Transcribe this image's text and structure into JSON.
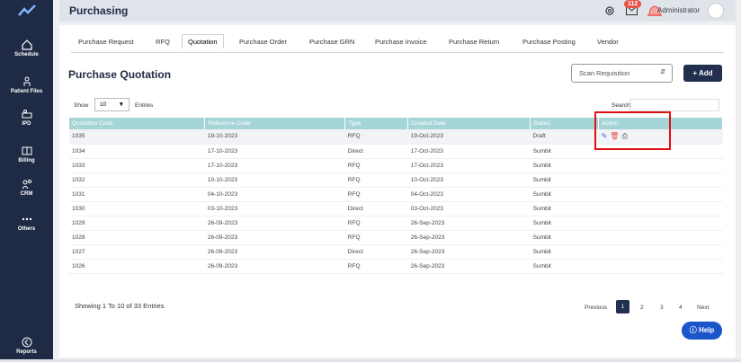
{
  "header": {
    "title": "Purchasing",
    "notifications": "112",
    "user": "Administrator"
  },
  "sidebar": {
    "items": [
      {
        "label": "Schedule",
        "icon": "home-icon"
      },
      {
        "label": "Patient Files",
        "icon": "person-icon"
      },
      {
        "label": "IPD",
        "icon": "bed-icon"
      },
      {
        "label": "Billing",
        "icon": "billing-icon"
      },
      {
        "label": "CRM",
        "icon": "crm-icon"
      },
      {
        "label": "Others",
        "icon": "more-icon"
      },
      {
        "label": "Reports",
        "icon": "reports-icon"
      }
    ]
  },
  "tabs": [
    "Purchase Request",
    "RFQ",
    "Quotation",
    "Purchase Order",
    "Purchase GRN",
    "Purchase Invoice",
    "Purchase Return",
    "Purchase Posting",
    "Vendor"
  ],
  "active_tab": "Quotation",
  "page": {
    "title": "Purchase Quotation",
    "scan_placeholder": "Scan Requisition",
    "add_label": "+ Add"
  },
  "list_controls": {
    "show": "Show",
    "page_size": "10",
    "entries": "Entries",
    "search": "Search:"
  },
  "table": {
    "columns": [
      "Quotation Code",
      "Reference Code",
      "Type",
      "Created Date",
      "Status",
      "Action"
    ],
    "rows": [
      [
        "1035",
        "19-10-2023",
        "RFQ",
        "19-Oct-2023",
        "Draft"
      ],
      [
        "1034",
        "17-10-2023",
        "Direct",
        "17-Oct-2023",
        "Sumbit"
      ],
      [
        "1033",
        "17-10-2023",
        "RFQ",
        "17-Oct-2023",
        "Sumbit"
      ],
      [
        "1032",
        "10-10-2023",
        "RFQ",
        "10-Oct-2023",
        "Sumbit"
      ],
      [
        "1031",
        "04-10-2023",
        "RFQ",
        "04-Oct-2023",
        "Sumbit"
      ],
      [
        "1030",
        "03-10-2023",
        "Direct",
        "03-Oct-2023",
        "Sumbit"
      ],
      [
        "1029",
        "26-09-2023",
        "RFQ",
        "26-Sep-2023",
        "Sumbit"
      ],
      [
        "1028",
        "26-09-2023",
        "RFQ",
        "26-Sep-2023",
        "Sumbit"
      ],
      [
        "1027",
        "26-09-2023",
        "Direct",
        "26-Sep-2023",
        "Sumbit"
      ],
      [
        "1026",
        "26-09-2023",
        "RFQ",
        "26-Sep-2023",
        "Sumbit"
      ]
    ]
  },
  "footer": {
    "summary": "Showing 1 To 10 of 33 Entries",
    "previous": "Previous",
    "pages": [
      "1",
      "2",
      "3",
      "4"
    ],
    "next": "Next"
  },
  "help": "Help",
  "colors": {
    "sidebar": "#1f2a44",
    "header_row": "#a6d5d8",
    "primary": "#232f4f",
    "highlight": "#e01010"
  }
}
